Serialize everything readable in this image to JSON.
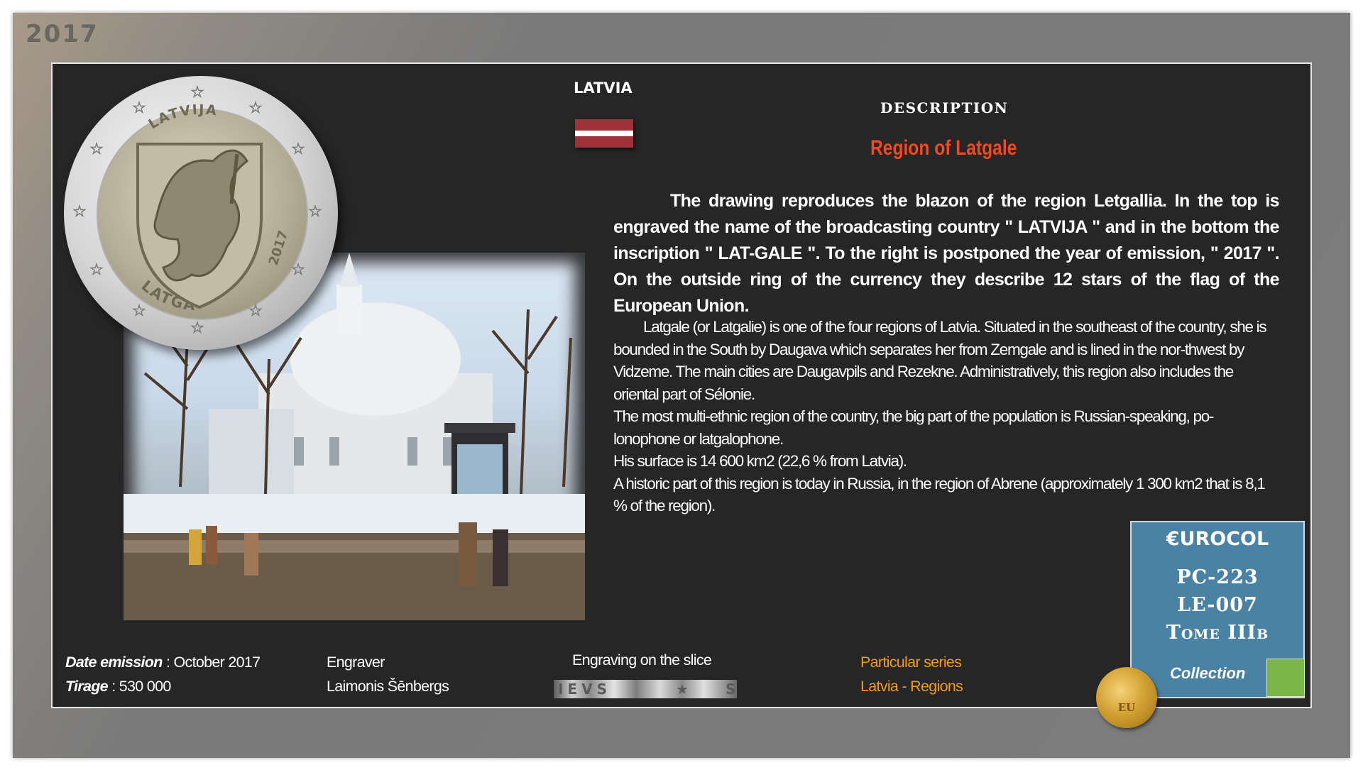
{
  "year_badge": "2017",
  "country": "LATVIA",
  "flag_colors": {
    "red": "#9e3039",
    "white": "#ffffff"
  },
  "description_heading": "DESCRIPTION",
  "region_title": "Region of Latgale",
  "paragraph1": "The drawing reproduces the blazon of the region Letgallia. In the top is engraved the name of the broadcasting country \" LATVIJA \" and in the bottom the inscription \" LAT-GALE \". To the right is postponed the year of emission, \" 2017 \". On the outside ring of the currency they describe 12 stars of the flag of the European Union.",
  "paragraph2": {
    "line1": "Latgale (or Latgalie) is one of the four regions of Latvia. Situated in the southeast of the country, she is bounded in the South by Daugava which separates her from Zemgale and is lined in the nor-thwest by Vidzeme. The main cities are Daugavpils and Rezekne. Administratively, this region also includes the oriental part of Sélonie.",
    "line2": "The most multi-ethnic region of the country, the big part of the population is Russian-speaking, po-lonophone or latgalophone.",
    "line3": "His surface is 14 600 km2 (22,6 % from Latvia).",
    "line4": "A historic part of this region is today in Russia, in the region of Abrene (approximately 1 300 km2 that is 8,1 % of the region)."
  },
  "coin": {
    "top_inscription": "LATVIJA",
    "bottom_inscription": "LATGALE",
    "year": "2017",
    "stars": 12
  },
  "eurocol": {
    "title": "€UROCOL",
    "code1": "PC-223",
    "code2": "LE-007",
    "code3": "Tome IIIb",
    "collection": "Collection",
    "accent_color": "#7ab648"
  },
  "seal_text": "EU",
  "footer": {
    "date_label": "Date emission",
    "date_value": "October  2017",
    "tirage_label": "Tirage",
    "tirage_value": "530 000",
    "engraver_label": "Engraver",
    "engraver_value": "Laimonis Šēnbergs",
    "slice_label": "Engraving on the slice",
    "series_label": "Particular series",
    "series_value": "Latvia - Regions"
  }
}
